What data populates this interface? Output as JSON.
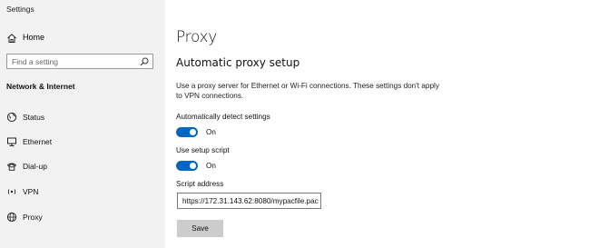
{
  "app": {
    "title": "Settings"
  },
  "sidebar": {
    "home_label": "Home",
    "search_placeholder": "Find a setting",
    "section_heading": "Network & Internet",
    "items": [
      {
        "label": "Status",
        "icon": "globe-status-icon"
      },
      {
        "label": "Ethernet",
        "icon": "ethernet-monitor-icon"
      },
      {
        "label": "Dial-up",
        "icon": "dial-up-phone-icon"
      },
      {
        "label": "VPN",
        "icon": "vpn-icon"
      },
      {
        "label": "Proxy",
        "icon": "globe-proxy-icon"
      }
    ]
  },
  "main": {
    "title": "Proxy",
    "section_title": "Automatic proxy setup",
    "description": "Use a proxy server for Ethernet or Wi-Fi connections. These settings don't apply to VPN connections.",
    "auto_detect": {
      "label": "Automatically detect settings",
      "state": "On",
      "enabled": true
    },
    "setup_script": {
      "label": "Use setup script",
      "state": "On",
      "enabled": true
    },
    "script_address": {
      "label": "Script address",
      "value": "https://172.31.143.62:8080/mypacfile.pac"
    },
    "save_label": "Save"
  },
  "colors": {
    "accent": "#0067c0",
    "sidebar_bg": "#f2f2f2",
    "button_bg": "#cccccc"
  }
}
